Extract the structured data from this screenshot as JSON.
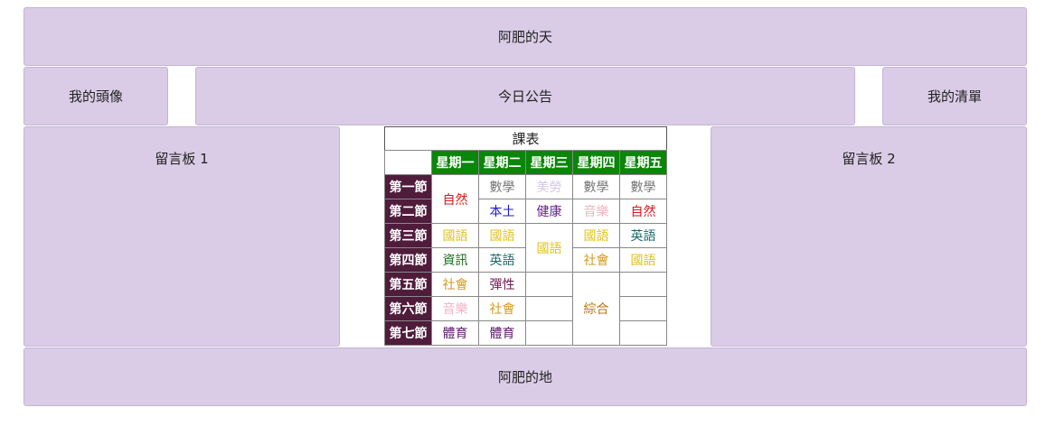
{
  "layout": {
    "header": "阿肥的天",
    "avatar": "我的頭像",
    "notice": "今日公告",
    "my_list": "我的清單",
    "board1": "留言板 1",
    "board2": "留言板 2",
    "footer": "阿肥的地"
  },
  "schedule": {
    "caption": "課表",
    "days": [
      "星期一",
      "星期二",
      "星期三",
      "星期四",
      "星期五"
    ],
    "periods": [
      "第一節",
      "第二節",
      "第三節",
      "第四節",
      "第五節",
      "第六節",
      "第七節"
    ],
    "colors": {
      "day_header_bg": "#0a860a",
      "period_header_bg": "#4f1c3b",
      "box_bg": "#dacce6"
    },
    "cells": {
      "mon_12": {
        "text": "自然",
        "color": "#d11c1c"
      },
      "mon_3": {
        "text": "國語",
        "color": "#e0c21a"
      },
      "mon_4": {
        "text": "資訊",
        "color": "#1b6b1b"
      },
      "mon_5": {
        "text": "社會",
        "color": "#d49a1c"
      },
      "mon_6": {
        "text": "音樂",
        "color": "#f2b3c3"
      },
      "mon_7": {
        "text": "體育",
        "color": "#5a1a6a"
      },
      "tue_1": {
        "text": "數學",
        "color": "#777777"
      },
      "tue_2": {
        "text": "本土",
        "color": "#1a1ad8"
      },
      "tue_3": {
        "text": "國語",
        "color": "#e0c21a"
      },
      "tue_4": {
        "text": "英語",
        "color": "#1a6a6a"
      },
      "tue_5": {
        "text": "彈性",
        "color": "#6a1a4a"
      },
      "tue_6": {
        "text": "社會",
        "color": "#d49a1c"
      },
      "tue_7": {
        "text": "體育",
        "color": "#5a1a6a"
      },
      "wed_1": {
        "text": "美勞",
        "color": "#d6c6e6"
      },
      "wed_2": {
        "text": "健康",
        "color": "#6a1a8a"
      },
      "wed_34": {
        "text": "國語",
        "color": "#e0c21a"
      },
      "thu_1": {
        "text": "數學",
        "color": "#777777"
      },
      "thu_2": {
        "text": "音樂",
        "color": "#f2b3c3"
      },
      "thu_3": {
        "text": "國語",
        "color": "#e0c21a"
      },
      "thu_4": {
        "text": "社會",
        "color": "#d49a1c"
      },
      "thu_567": {
        "text": "綜合",
        "color": "#b8761a"
      },
      "fri_1": {
        "text": "數學",
        "color": "#777777"
      },
      "fri_2": {
        "text": "自然",
        "color": "#d11c1c"
      },
      "fri_3": {
        "text": "英語",
        "color": "#1a6a6a"
      },
      "fri_4": {
        "text": "國語",
        "color": "#e0c21a"
      }
    }
  }
}
